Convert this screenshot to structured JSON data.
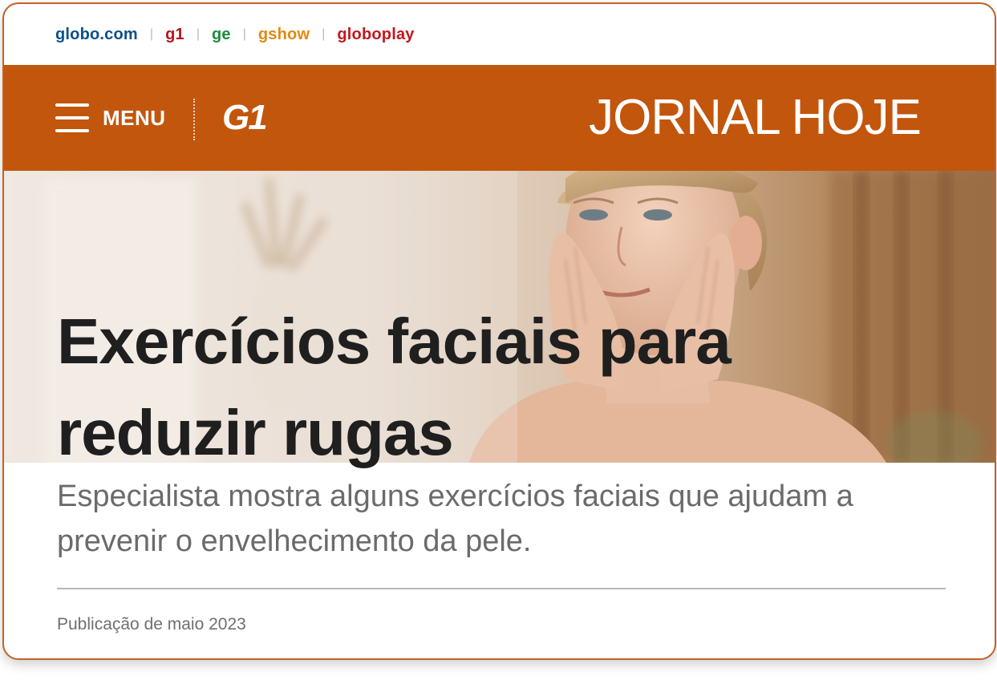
{
  "network": {
    "links": [
      {
        "label": "globo.com",
        "color": "#0b4f8a"
      },
      {
        "label": "g1",
        "color": "#b5151b"
      },
      {
        "label": "ge",
        "color": "#1c8c3a"
      },
      {
        "label": "gshow",
        "color": "#e08a10"
      },
      {
        "label": "globoplay",
        "color": "#c4161c"
      }
    ],
    "separator": "|"
  },
  "header": {
    "menu_label": "MENU",
    "logo_text": "G1",
    "program_name": "JORNAL HOJE",
    "background_color": "#c2560c"
  },
  "article": {
    "headline": "Exercícios faciais para reduzir rugas",
    "standfirst": "Especialista mostra alguns exercícios faciais que ajudam a prevenir o envelhecimento da pele.",
    "publication": "Publicação de maio 2023"
  },
  "icons": {
    "menu": "hamburger-icon"
  }
}
